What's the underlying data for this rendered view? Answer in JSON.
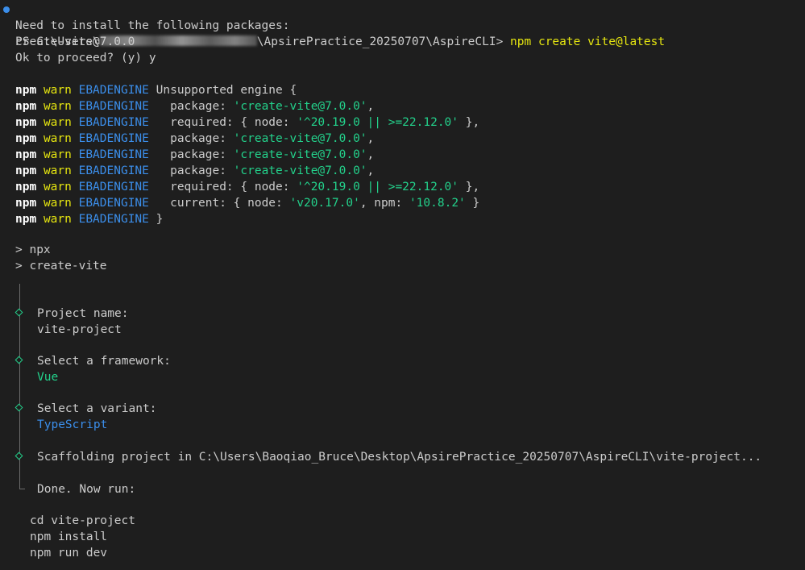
{
  "colors": {
    "background": "#1e1e1e",
    "default_text": "#cccccc",
    "npm_warn": "#e5e510",
    "ebadengine": "#3b8eea",
    "string_green": "#23d18b",
    "prompt_dot": "#3b8eea",
    "tree_line": "#6b6b6b"
  },
  "prompt": {
    "prefix": "PS C:\\Users\\",
    "suffix": "\\ApsirePractice_20250707\\AspireCLI> ",
    "command": "npm create vite@latest"
  },
  "install_notice": {
    "line1": "Need to install the following packages:",
    "line2": "create-vite@7.0.0",
    "line3": "Ok to proceed? (y) y"
  },
  "warnings": {
    "npm": "npm",
    "warn": "warn",
    "code": "EBADENGINE",
    "lines": [
      {
        "pre": " Unsupported engine {",
        "segments": []
      },
      {
        "pre": "   package: ",
        "str1": "'create-vite@7.0.0'",
        "mid": ",",
        "str2": "",
        "post": ""
      },
      {
        "pre": "   required: { node: ",
        "str1": "'^20.19.0 || >=22.12.0'",
        "mid": " },",
        "str2": "",
        "post": ""
      },
      {
        "pre": "   package: ",
        "str1": "'create-vite@7.0.0'",
        "mid": ",",
        "str2": "",
        "post": ""
      },
      {
        "pre": "   package: ",
        "str1": "'create-vite@7.0.0'",
        "mid": ",",
        "str2": "",
        "post": ""
      },
      {
        "pre": "   package: ",
        "str1": "'create-vite@7.0.0'",
        "mid": ",",
        "str2": "",
        "post": ""
      },
      {
        "pre": "   required: { node: ",
        "str1": "'^20.19.0 || >=22.12.0'",
        "mid": " },",
        "str2": "",
        "post": ""
      },
      {
        "pre": "   current: { node: ",
        "str1": "'v20.17.0'",
        "mid": ", npm: ",
        "str2": "'10.8.2'",
        "post": " }"
      },
      {
        "pre": " }",
        "segments": []
      }
    ]
  },
  "npx": {
    "line1": "> npx",
    "line2": "> create-vite"
  },
  "wizard": {
    "project_name_label": "Project name:",
    "project_name_value": "vite-project",
    "framework_label": "Select a framework:",
    "framework_value": "Vue",
    "variant_label": "Select a variant:",
    "variant_value": "TypeScript",
    "scaffold_text": "Scaffolding project in C:\\Users\\Baoqiao_Bruce\\Desktop\\ApsirePractice_20250707\\AspireCLI\\vite-project...",
    "done_text": "Done. Now run:"
  },
  "next_steps": [
    "cd vite-project",
    "npm install",
    "npm run dev"
  ]
}
